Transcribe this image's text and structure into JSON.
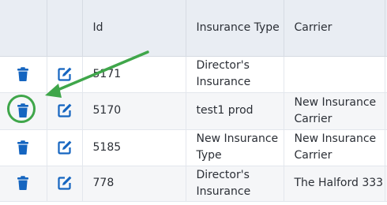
{
  "table": {
    "headers": {
      "delete": "",
      "edit": "",
      "id": "Id",
      "insurance_type": "Insurance Type",
      "carrier": "Carrier"
    },
    "rows": [
      {
        "id": "5171",
        "insurance_type": "Director's Insurance",
        "carrier": ""
      },
      {
        "id": "5170",
        "insurance_type": "test1 prod",
        "carrier": "New Insurance Carrier"
      },
      {
        "id": "5185",
        "insurance_type": "New Insurance Type",
        "carrier": "New Insurance Carrier"
      },
      {
        "id": "778",
        "insurance_type": "Director's Insurance",
        "carrier": "The Halford 333"
      }
    ]
  },
  "icons": {
    "delete": "trash-icon",
    "edit": "edit-icon"
  },
  "colors": {
    "icon_blue": "#1565c0",
    "header_bg": "#e9edf3",
    "stripe_bg": "#f5f6f8",
    "annotation_green": "#3fa64a"
  },
  "annotation": {
    "highlighted_row": 1,
    "highlighted_control": "delete"
  }
}
